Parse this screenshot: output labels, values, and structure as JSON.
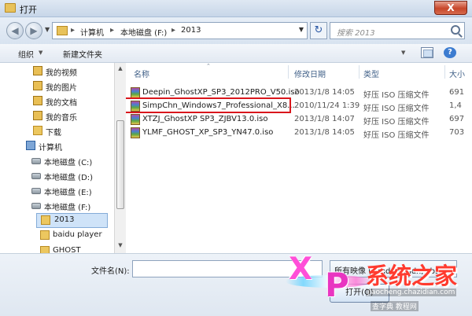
{
  "window": {
    "title": "打开",
    "close_label": "X"
  },
  "address": {
    "crumbs": [
      "计算机",
      "本地磁盘 (F:)",
      "2013"
    ],
    "search_placeholder": "搜索 2013"
  },
  "toolbar": {
    "organize_label": "组织",
    "new_folder_label": "新建文件夹"
  },
  "sidebar": {
    "items": [
      {
        "label": "我的视频",
        "icon": "folder-icon"
      },
      {
        "label": "我的图片",
        "icon": "folder-icon"
      },
      {
        "label": "我的文档",
        "icon": "folder-icon"
      },
      {
        "label": "我的音乐",
        "icon": "folder-icon"
      },
      {
        "label": "下载",
        "icon": "folder-icon"
      },
      {
        "label": "计算机",
        "icon": "computer-icon"
      },
      {
        "label": "本地磁盘 (C:)",
        "icon": "drive-icon"
      },
      {
        "label": "本地磁盘 (D:)",
        "icon": "drive-icon"
      },
      {
        "label": "本地磁盘 (E:)",
        "icon": "drive-icon"
      },
      {
        "label": "本地磁盘 (F:)",
        "icon": "drive-icon"
      },
      {
        "label": "2013",
        "icon": "folder-icon"
      },
      {
        "label": "baidu player",
        "icon": "folder-icon"
      },
      {
        "label": "GHOST",
        "icon": "folder-icon"
      }
    ]
  },
  "table": {
    "headers": [
      "名称",
      "修改日期",
      "类型",
      "大小"
    ],
    "rows": [
      {
        "name": "Deepin_GhostXP_SP3_2012PRO_V50.iso",
        "date": "2013/1/8 14:05",
        "type": "好压 ISO 压缩文件",
        "size": "691"
      },
      {
        "name": "SimpChn_Windows7_Professional_X8...",
        "date": "2010/11/24 1:39",
        "type": "好压 ISO 压缩文件",
        "size": "1,4"
      },
      {
        "name": "XTZJ_GhostXP SP3_ZJBV13.0.iso",
        "date": "2013/1/8 14:07",
        "type": "好压 ISO 压缩文件",
        "size": "697"
      },
      {
        "name": "YLMF_GHOST_XP_SP3_YN47.0.iso",
        "date": "2013/1/8 14:05",
        "type": "好压 ISO 压缩文件",
        "size": "703"
      }
    ]
  },
  "bottom": {
    "filename_label": "文件名(N):",
    "filename_value": "",
    "filter_value": "所有映像 (*.mds;*.mdx;*.b5t;*",
    "open_label": "打开(O)"
  },
  "watermark": {
    "x": "X",
    "p": "P",
    "cn": "系统之家",
    "site1": "jiaocheng.chazidian.com",
    "site2": "查字典 教程网"
  },
  "colors": {
    "highlight": "#d9161c",
    "selected_tree": "#cfe3f8"
  }
}
